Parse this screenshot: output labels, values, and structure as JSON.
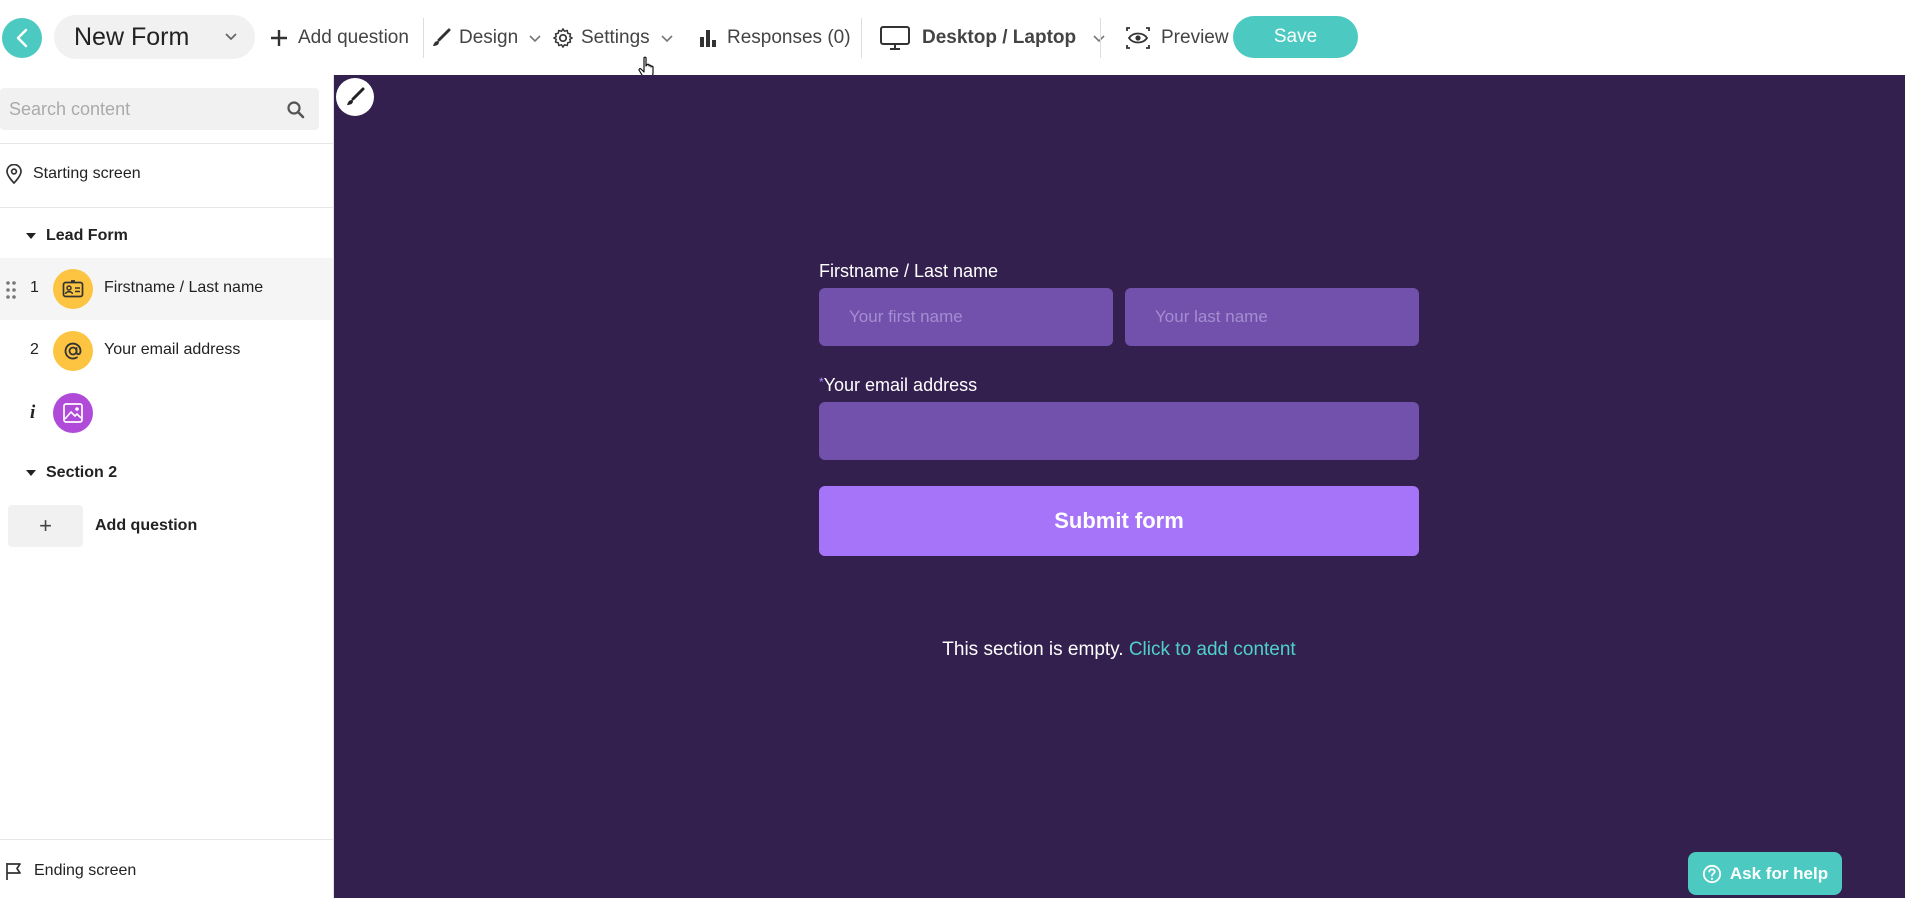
{
  "header": {
    "form_name": "New Form",
    "add_question": "Add question",
    "design": "Design",
    "settings": "Settings",
    "responses": "Responses (0)",
    "device": "Desktop / Laptop",
    "preview": "Preview",
    "save": "Save"
  },
  "sidebar": {
    "search_placeholder": "Search content",
    "starting_screen": "Starting screen",
    "sections": [
      {
        "title": "Lead Form",
        "items": [
          {
            "number": "1",
            "label": "Firstname / Last name"
          },
          {
            "number": "2",
            "label": "Your email address"
          },
          {
            "number": "i",
            "label": ""
          }
        ]
      },
      {
        "title": "Section 2",
        "add_label": "Add question",
        "add_symbol": "+"
      }
    ],
    "ending_screen": "Ending screen"
  },
  "canvas": {
    "name_label": "Firstname / Last name",
    "first_name_placeholder": "Your first name",
    "last_name_placeholder": "Your last name",
    "email_required_mark": "*",
    "email_label": "Your email address",
    "submit_label": "Submit form",
    "empty_text": "This section is empty.",
    "empty_link": "Click to add content",
    "help_label": "Ask for help"
  },
  "colors": {
    "accent_teal": "#4cc9c0",
    "canvas_bg": "#33204f",
    "input_bg": "#7251ad",
    "submit_bg": "#a674f8",
    "badge_yellow": "#fcc440",
    "badge_purple": "#b04ad8"
  }
}
